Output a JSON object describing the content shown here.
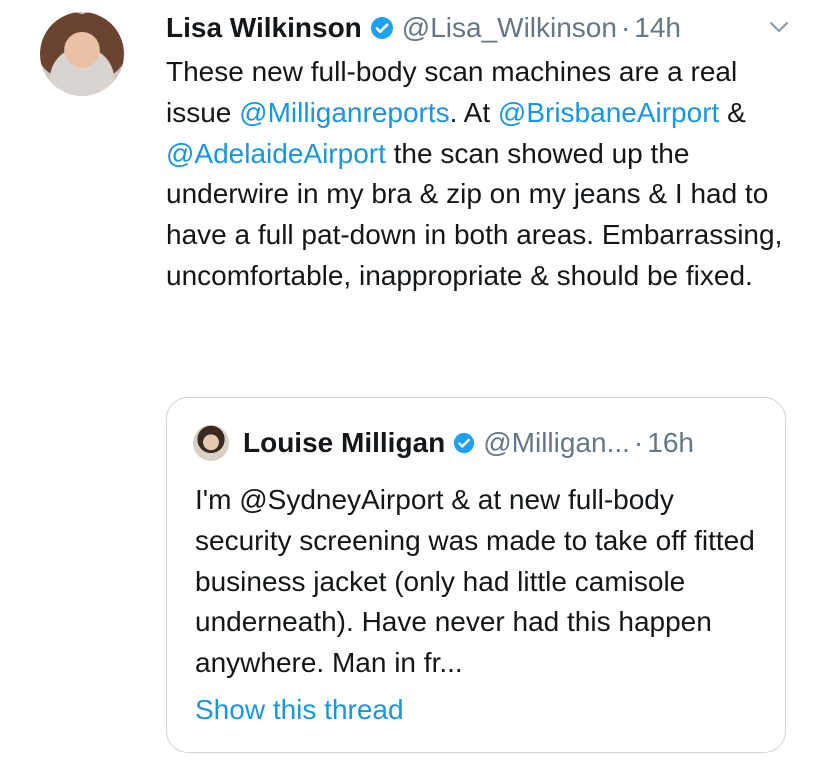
{
  "tweet": {
    "author_name": "Lisa Wilkinson",
    "author_handle": "@Lisa_Wilkinson",
    "separator": "·",
    "time": "14h",
    "text_parts": {
      "p1": "These new full-body scan machines are a real issue ",
      "m1": "@Milliganreports",
      "p2": ". At ",
      "m2": "@BrisbaneAirport",
      "p3": " & ",
      "m3": "@AdelaideAirport",
      "p4": " the scan showed up the underwire in my bra & zip on my jeans & I had to have a full pat-down in both areas. Embarrassing, uncomfortable, inappropriate & should be fixed."
    }
  },
  "quoted_tweet": {
    "author_name": "Louise Milligan",
    "author_handle": "@Milligan...",
    "separator": "·",
    "time": "16h",
    "text": "I'm @SydneyAirport & at new full-body security screening was made to take off fitted business jacket (only had little camisole underneath). Have never had this happen anywhere. Man in fr...",
    "show_thread_label": "Show this thread"
  },
  "colors": {
    "mention": "#1b95e0",
    "secondary": "#657786",
    "border": "#ccd6dd",
    "verified": "#1da1f2"
  },
  "icons": {
    "verified": "verified-badge-icon",
    "menu": "chevron-down-icon"
  }
}
